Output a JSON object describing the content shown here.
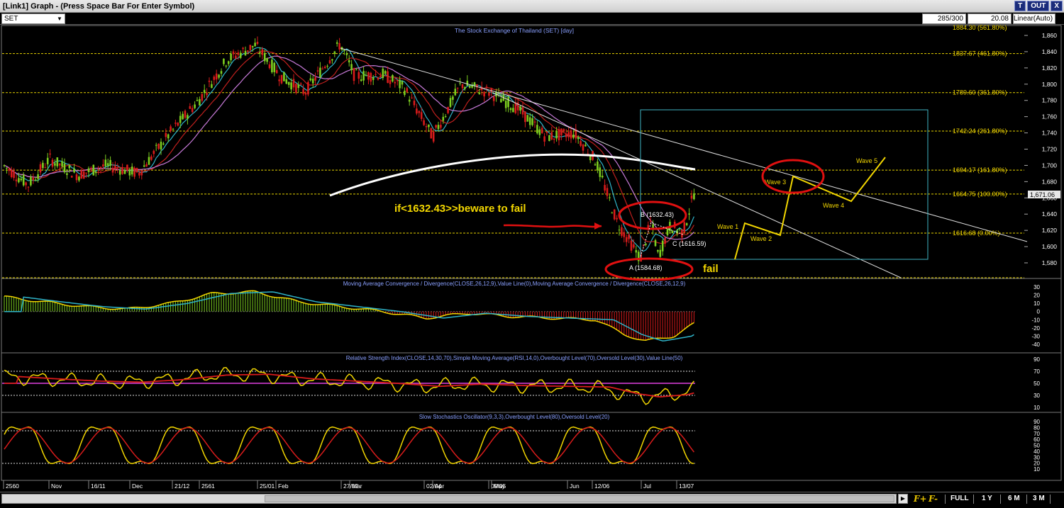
{
  "window": {
    "title": "[Link1] Graph  - (Press Space Bar For Enter Symbol)",
    "buttons": [
      "T",
      "OUT",
      "X"
    ]
  },
  "toolbar": {
    "symbol": "SET",
    "count": "285/300",
    "value": "20.08",
    "scale": "Linear(Auto)"
  },
  "main_panel": {
    "title": "The Stock Exchange of Thailand (SET) [day]",
    "top_clip_label": "1884.30 (561.80%)",
    "y_ticks": [
      "1,860",
      "1,840",
      "1,820",
      "1,800",
      "1,780",
      "1,760",
      "1,740",
      "1,720",
      "1,700",
      "1,680",
      "1,660",
      "1,640",
      "1,620",
      "1,600",
      "1,580"
    ],
    "last_price": "1,671.06",
    "fib_levels": [
      {
        "label": "1837.67 (461.80%)",
        "value": 1837.67
      },
      {
        "label": "1789.60 (361.80%)",
        "value": 1789.6
      },
      {
        "label": "1742.24 (261.80%)",
        "value": 1742.24
      },
      {
        "label": "1694.17 (161.80%)",
        "value": 1694.17
      },
      {
        "label": "1664.75 (100.00%)",
        "value": 1664.75
      },
      {
        "label": "1616.68 (0.00%)",
        "value": 1616.68
      }
    ],
    "annotations": {
      "note": "if<1632.43>>beware to fail",
      "fail": "fail",
      "point_a": "A (1584.68)",
      "point_b": "B (1632.43)",
      "point_c": "C (1616.59)",
      "waves": [
        "Wave 1",
        "Wave 2",
        "Wave 3",
        "Wave 4",
        "Wave 5"
      ]
    }
  },
  "macd_panel": {
    "title": "Moving Average Convergence / Divergence(CLOSE,26,12,9),Value Line(0),Moving Average Convergence / Divergence(CLOSE,26,12,9)",
    "y_ticks": [
      "30",
      "20",
      "10",
      "0",
      "-10",
      "-20",
      "-30",
      "-40"
    ]
  },
  "rsi_panel": {
    "title": "Relative Strength Index(CLOSE,14,30,70),Simple Moving Average(RSI,14,0),Overbought Level(70),Oversold Level(30),Value Line(50)",
    "y_ticks": [
      "90",
      "70",
      "50",
      "30",
      "10"
    ]
  },
  "stoch_panel": {
    "title": "Slow Stochastics Oscillator(9,3,3),Overbought Level(80),Oversold Level(20)",
    "y_ticks": [
      "90",
      "80",
      "70",
      "60",
      "50",
      "40",
      "30",
      "20",
      "10"
    ]
  },
  "x_axis": {
    "labels": [
      "2560",
      "Nov",
      "16/11",
      "Dec",
      "21/12",
      "2561",
      "25/01",
      "Feb",
      "27/02",
      "Mar",
      "02/04",
      "Apr",
      "09/05",
      "May",
      "Jun",
      "12/06",
      "Jul",
      "13/07"
    ]
  },
  "bottom_bar": {
    "f_plus": "F+",
    "f_minus": "F-",
    "ranges": [
      "FULL",
      "1 Y",
      "6 M",
      "3 M"
    ]
  },
  "colors": {
    "candle_up": "#7ccd1f",
    "candle_down": "#d81b1b",
    "grid_dotted": "#e6d200",
    "text_yellow": "#f2d600",
    "axis_text": "#ffffff",
    "title_blue": "#8aa0ff",
    "ma_cyan": "#2fb4c9",
    "ma_red": "#c0201e",
    "ma_violet": "#c77ad8",
    "annotation_red": "#e01010",
    "box_cyan": "#3fb3c2"
  }
}
